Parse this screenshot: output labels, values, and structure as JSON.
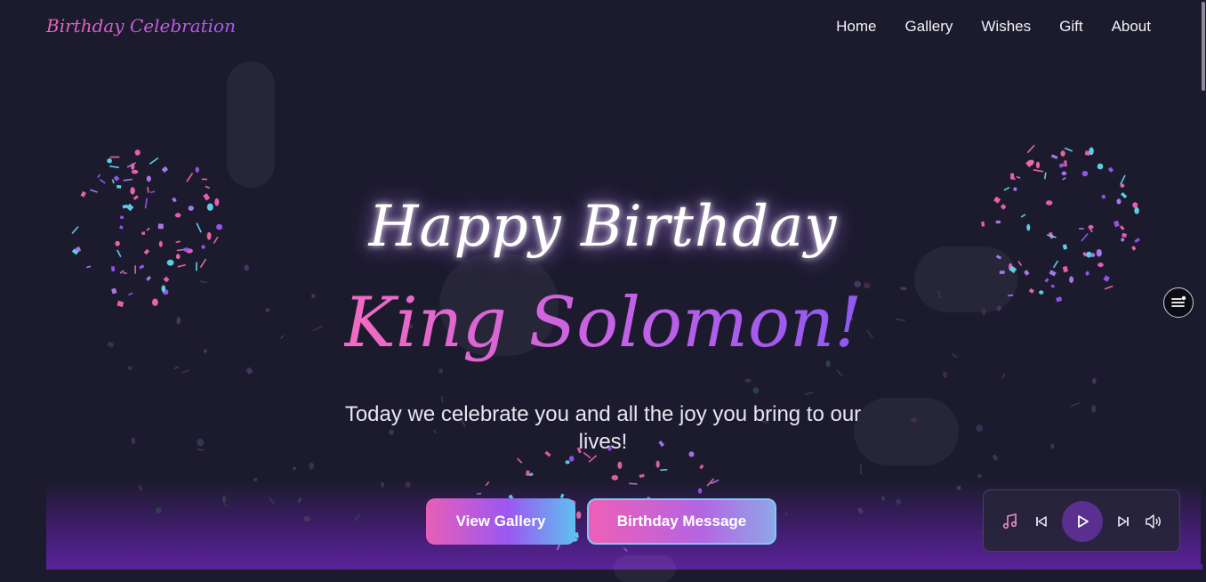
{
  "header": {
    "logo": "Birthday Celebration",
    "nav": [
      "Home",
      "Gallery",
      "Wishes",
      "Gift",
      "About"
    ]
  },
  "hero": {
    "title": "Happy Birthday",
    "name": "King Solomon!",
    "subtitle_line1": "Today we celebrate you and all the joy you bring to our",
    "subtitle_line2": "lives!"
  },
  "buttons": {
    "gallery": "View Gallery",
    "message": "Birthday Message"
  },
  "player": {
    "icons": [
      "music-note-icon",
      "previous-icon",
      "play-icon",
      "next-icon",
      "volume-icon"
    ]
  },
  "colors": {
    "background": "#1c1b2e",
    "accent_pink": "#f062b6",
    "accent_purple": "#9b57f2",
    "accent_cyan": "#5fd8f0"
  }
}
